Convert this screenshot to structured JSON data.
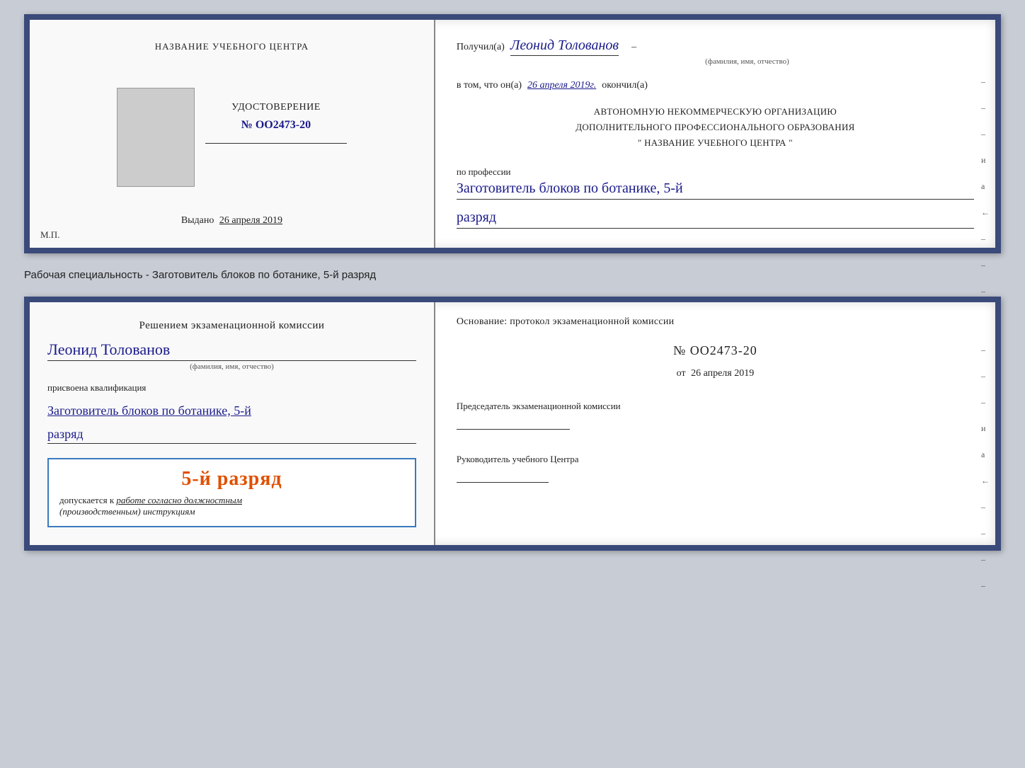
{
  "card1": {
    "left": {
      "institution": "НАЗВАНИЕ УЧЕБНОГО ЦЕНТРА",
      "certificate_label": "УДОСТОВЕРЕНИЕ",
      "certificate_number": "№ OO2473-20",
      "issued_prefix": "Выдано",
      "issued_date": "26 апреля 2019",
      "mp_label": "М.П."
    },
    "right": {
      "received_prefix": "Получил(а)",
      "recipient_name": "Леонид Толованов",
      "name_sublabel": "(фамилия, имя, отчество)",
      "date_prefix": "в том, что он(а)",
      "date_handwritten": "26 апреля 2019г.",
      "date_suffix": "окончил(а)",
      "org_line1": "АВТОНОМНУЮ НЕКОММЕРЧЕСКУЮ ОРГАНИЗАЦИЮ",
      "org_line2": "ДОПОЛНИТЕЛЬНОГО ПРОФЕССИОНАЛЬНОГО ОБРАЗОВАНИЯ",
      "org_line3": "\"  НАЗВАНИЕ УЧЕБНОГО ЦЕНТРА  \"",
      "profession_prefix": "по профессии",
      "profession_handwritten": "Заготовитель блоков по ботанике, 5-й",
      "rank_handwritten": "разряд"
    }
  },
  "between_label": "Рабочая специальность - Заготовитель блоков по ботанике, 5-й разряд",
  "card2": {
    "left": {
      "decision_text": "Решением экзаменационной комиссии",
      "person_name": "Леонид Толованов",
      "name_sublabel": "(фамилия, имя, отчество)",
      "qual_prefix": "присвоена квалификация",
      "qual_handwritten": "Заготовитель блоков по ботанике, 5-й",
      "rank_handwritten": "разряд",
      "highlight_rank": "5-й разряд",
      "allowed_prefix": "допускается к",
      "allowed_text": "работе согласно должностным",
      "allowed_text2": "(производственным) инструкциям"
    },
    "right": {
      "basis_text": "Основание: протокол экзаменационной комиссии",
      "protocol_number": "№  OO2473-20",
      "from_prefix": "от",
      "from_date": "26 апреля 2019",
      "chairman_label": "Председатель экзаменационной комиссии",
      "director_label": "Руководитель учебного Центра"
    }
  },
  "dashes": [
    "-",
    "-",
    "-",
    "и",
    "а",
    "←",
    "-",
    "-",
    "-",
    "-",
    "-"
  ]
}
